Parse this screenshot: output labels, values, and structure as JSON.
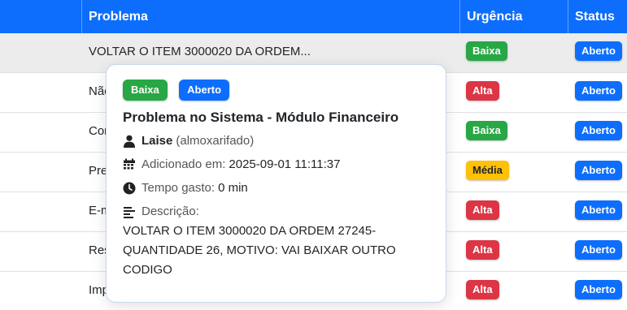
{
  "table": {
    "headers": {
      "problema": "Problema",
      "urgencia": "Urgência",
      "status": "Status"
    },
    "rows": [
      {
        "problem": "VOLTAR O ITEM 3000020 DA ORDEM...",
        "urgency": "Baixa",
        "status": "Aberto"
      },
      {
        "problem": "Não consigo acessar o Protheus",
        "urgency": "Alta",
        "status": "Aberto"
      },
      {
        "problem": "Computador não liga",
        "urgency": "Baixa",
        "status": "Aberto"
      },
      {
        "problem": "Preciso de acesso a pasta",
        "urgency": "Média",
        "status": "Aberto"
      },
      {
        "problem": "E-mail não sincroniza no celular",
        "urgency": "Alta",
        "status": "Aberto"
      },
      {
        "problem": "Resetar senha do usuário",
        "urgency": "Alta",
        "status": "Aberto"
      },
      {
        "problem": "Impressora não está imprimindo",
        "urgency": "Alta",
        "status": "Aberto"
      }
    ]
  },
  "popover": {
    "urgency": "Baixa",
    "status": "Aberto",
    "title": "Problema no Sistema - Módulo Financeiro",
    "user": "Laise",
    "department": "(almoxarifado)",
    "added_label": "Adicionado em:",
    "added_value": "2025-09-01 11:11:37",
    "time_label": "Tempo gasto:",
    "time_value": "0 min",
    "desc_label": "Descrição:",
    "description": "VOLTAR O ITEM 3000020 DA ORDEM 27245- QUANTIDADE 26, MOTIVO: VAI BAIXAR OUTRO CODIGO"
  },
  "colors": {
    "header": "#0d6efd",
    "baixa": "#28a745",
    "alta": "#dc3545",
    "media": "#ffc107",
    "aberto": "#0d6efd"
  }
}
